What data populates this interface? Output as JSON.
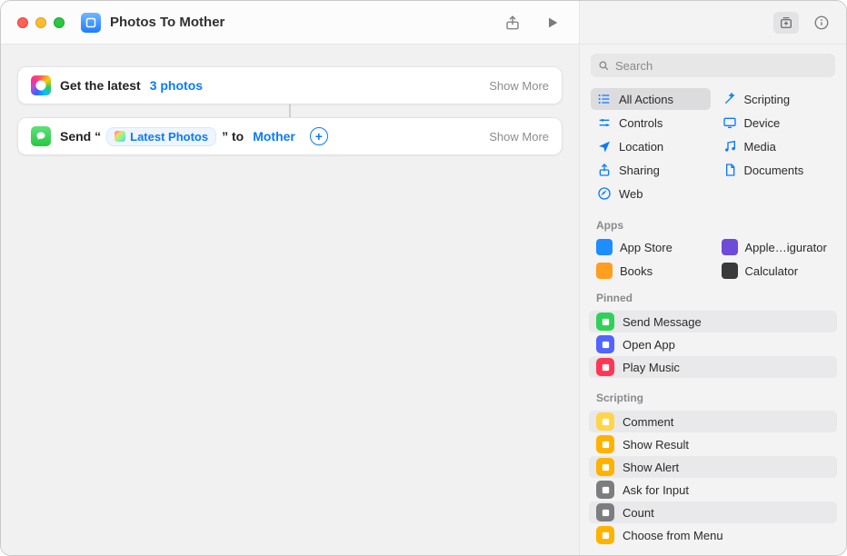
{
  "title": "Photos To Mother",
  "toolbar": {
    "share": "share",
    "run": "run"
  },
  "actions": [
    {
      "icon": "photos",
      "prefix": "Get the latest",
      "token": "3 photos",
      "show_more": "Show More"
    },
    {
      "icon": "messages",
      "prefix": "Send “",
      "pill": "Latest Photos",
      "mid": "” to",
      "token": "Mother",
      "show_more": "Show More"
    }
  ],
  "search_placeholder": "Search",
  "categories": [
    {
      "label": "All Actions",
      "icon": "list",
      "color": "#0a7aff",
      "sel": true
    },
    {
      "label": "Scripting",
      "icon": "wand",
      "color": "#0a7aff"
    },
    {
      "label": "Controls",
      "icon": "sliders",
      "color": "#0a7aff"
    },
    {
      "label": "Device",
      "icon": "device",
      "color": "#0a7aff"
    },
    {
      "label": "Location",
      "icon": "nav",
      "color": "#0a7aff"
    },
    {
      "label": "Media",
      "icon": "music",
      "color": "#0a7aff"
    },
    {
      "label": "Sharing",
      "icon": "share",
      "color": "#0a7aff"
    },
    {
      "label": "Documents",
      "icon": "doc",
      "color": "#0a7aff"
    },
    {
      "label": "Web",
      "icon": "safari",
      "color": "#0a7aff"
    }
  ],
  "section_apps": "Apps",
  "apps": [
    {
      "label": "App Store",
      "color": "#1e8dff"
    },
    {
      "label": "Apple…igurator",
      "color": "#6f4bd9"
    },
    {
      "label": "Books",
      "color": "#ff9e1f"
    },
    {
      "label": "Calculator",
      "color": "#3a3a3c"
    }
  ],
  "section_pinned": "Pinned",
  "pinned": [
    {
      "label": "Send Message",
      "color": "#30d158"
    },
    {
      "label": "Open App",
      "color": "#5164ff"
    },
    {
      "label": "Play Music",
      "color": "#ff3754"
    }
  ],
  "section_scripting": "Scripting",
  "scripting": [
    {
      "label": "Comment",
      "color": "#ffd54a"
    },
    {
      "label": "Show Result",
      "color": "#ffb200"
    },
    {
      "label": "Show Alert",
      "color": "#ffb200"
    },
    {
      "label": "Ask for Input",
      "color": "#7d7d80"
    },
    {
      "label": "Count",
      "color": "#7d7d80"
    },
    {
      "label": "Choose from Menu",
      "color": "#ffb200"
    }
  ]
}
